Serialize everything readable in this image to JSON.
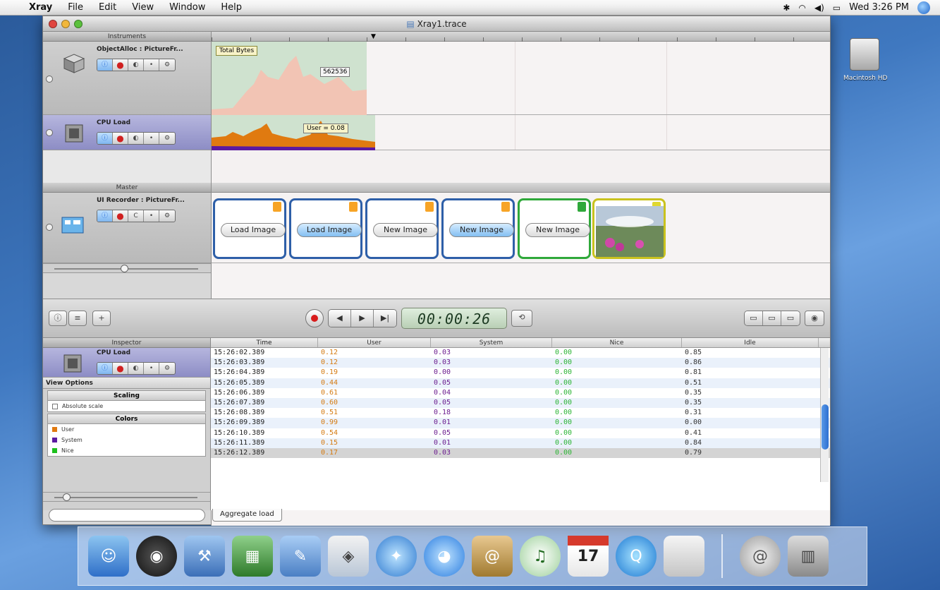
{
  "menubar": {
    "app_name": "Xray",
    "items": [
      "File",
      "Edit",
      "View",
      "Window",
      "Help"
    ],
    "clock": "Wed 3:26 PM"
  },
  "window": {
    "title": "Xray1.trace"
  },
  "instruments": {
    "header": "Instruments",
    "items": [
      {
        "name": "ObjectAlloc : PictureFr..."
      },
      {
        "name": "CPU Load"
      }
    ]
  },
  "timeline": {
    "alloc_label": "Total Bytes",
    "alloc_value": "562536",
    "cpu_tooltip": "User = 0.08"
  },
  "master": {
    "header": "Master",
    "recorder_name": "UI Recorder : PictureFr...",
    "cards": [
      {
        "label": "Load Image",
        "highlight": false,
        "color": "blue"
      },
      {
        "label": "Load Image",
        "highlight": true,
        "color": "blue"
      },
      {
        "label": "New Image",
        "highlight": false,
        "color": "blue"
      },
      {
        "label": "New Image",
        "highlight": true,
        "color": "blue"
      },
      {
        "label": "New Image",
        "highlight": false,
        "color": "green"
      }
    ]
  },
  "transport": {
    "time": "00:00:26"
  },
  "inspector": {
    "header": "Inspector",
    "instrument_name": "CPU Load",
    "view_options": "View Options",
    "scaling_header": "Scaling",
    "absolute_scale": "Absolute scale",
    "colors_header": "Colors",
    "legend": [
      {
        "name": "User",
        "color": "#e07a10"
      },
      {
        "name": "System",
        "color": "#5b1aa0"
      },
      {
        "name": "Nice",
        "color": "#1dc01d"
      }
    ]
  },
  "table": {
    "columns": [
      "Time",
      "User",
      "System",
      "Nice",
      "Idle"
    ],
    "rows": [
      [
        "15:26:02.389",
        "0.12",
        "0.03",
        "0.00",
        "0.85"
      ],
      [
        "15:26:03.389",
        "0.12",
        "0.03",
        "0.00",
        "0.86"
      ],
      [
        "15:26:04.389",
        "0.19",
        "0.00",
        "0.00",
        "0.81"
      ],
      [
        "15:26:05.389",
        "0.44",
        "0.05",
        "0.00",
        "0.51"
      ],
      [
        "15:26:06.389",
        "0.61",
        "0.04",
        "0.00",
        "0.35"
      ],
      [
        "15:26:07.389",
        "0.60",
        "0.05",
        "0.00",
        "0.35"
      ],
      [
        "15:26:08.389",
        "0.51",
        "0.18",
        "0.00",
        "0.31"
      ],
      [
        "15:26:09.389",
        "0.99",
        "0.01",
        "0.00",
        "0.00"
      ],
      [
        "15:26:10.389",
        "0.54",
        "0.05",
        "0.00",
        "0.41"
      ],
      [
        "15:26:11.389",
        "0.15",
        "0.01",
        "0.00",
        "0.84"
      ],
      [
        "15:26:12.389",
        "0.17",
        "0.03",
        "0.00",
        "0.79"
      ]
    ]
  },
  "footer": {
    "tab_label": "Aggregate load"
  },
  "desktop": {
    "hd_label": "Macintosh HD",
    "calendar_day": "17"
  },
  "dock": {
    "icons": [
      "finder-icon",
      "dashboard-icon",
      "xcode-icon",
      "interface-builder-icon",
      "image-editor-icon",
      "preview-icon",
      "safari-icon",
      "ichat-icon",
      "address-book-icon",
      "itunes-icon",
      "ical-icon",
      "quicktime-icon",
      "system-preferences-icon",
      "downloads-icon",
      "trash-icon"
    ]
  }
}
